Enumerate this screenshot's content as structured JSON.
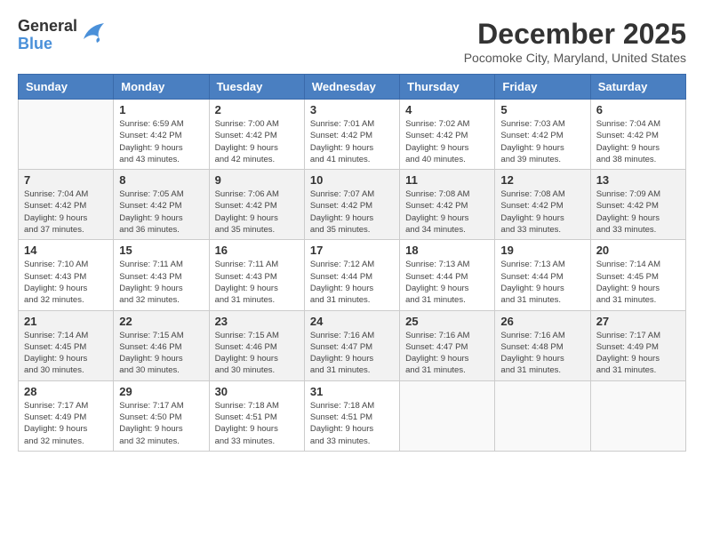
{
  "header": {
    "logo": {
      "general": "General",
      "blue": "Blue"
    },
    "title": "December 2025",
    "location": "Pocomoke City, Maryland, United States"
  },
  "calendar": {
    "weekdays": [
      "Sunday",
      "Monday",
      "Tuesday",
      "Wednesday",
      "Thursday",
      "Friday",
      "Saturday"
    ],
    "rows": [
      [
        {
          "day": "",
          "info": ""
        },
        {
          "day": "1",
          "info": "Sunrise: 6:59 AM\nSunset: 4:42 PM\nDaylight: 9 hours\nand 43 minutes."
        },
        {
          "day": "2",
          "info": "Sunrise: 7:00 AM\nSunset: 4:42 PM\nDaylight: 9 hours\nand 42 minutes."
        },
        {
          "day": "3",
          "info": "Sunrise: 7:01 AM\nSunset: 4:42 PM\nDaylight: 9 hours\nand 41 minutes."
        },
        {
          "day": "4",
          "info": "Sunrise: 7:02 AM\nSunset: 4:42 PM\nDaylight: 9 hours\nand 40 minutes."
        },
        {
          "day": "5",
          "info": "Sunrise: 7:03 AM\nSunset: 4:42 PM\nDaylight: 9 hours\nand 39 minutes."
        },
        {
          "day": "6",
          "info": "Sunrise: 7:04 AM\nSunset: 4:42 PM\nDaylight: 9 hours\nand 38 minutes."
        }
      ],
      [
        {
          "day": "7",
          "info": "Sunrise: 7:04 AM\nSunset: 4:42 PM\nDaylight: 9 hours\nand 37 minutes."
        },
        {
          "day": "8",
          "info": "Sunrise: 7:05 AM\nSunset: 4:42 PM\nDaylight: 9 hours\nand 36 minutes."
        },
        {
          "day": "9",
          "info": "Sunrise: 7:06 AM\nSunset: 4:42 PM\nDaylight: 9 hours\nand 35 minutes."
        },
        {
          "day": "10",
          "info": "Sunrise: 7:07 AM\nSunset: 4:42 PM\nDaylight: 9 hours\nand 35 minutes."
        },
        {
          "day": "11",
          "info": "Sunrise: 7:08 AM\nSunset: 4:42 PM\nDaylight: 9 hours\nand 34 minutes."
        },
        {
          "day": "12",
          "info": "Sunrise: 7:08 AM\nSunset: 4:42 PM\nDaylight: 9 hours\nand 33 minutes."
        },
        {
          "day": "13",
          "info": "Sunrise: 7:09 AM\nSunset: 4:42 PM\nDaylight: 9 hours\nand 33 minutes."
        }
      ],
      [
        {
          "day": "14",
          "info": "Sunrise: 7:10 AM\nSunset: 4:43 PM\nDaylight: 9 hours\nand 32 minutes."
        },
        {
          "day": "15",
          "info": "Sunrise: 7:11 AM\nSunset: 4:43 PM\nDaylight: 9 hours\nand 32 minutes."
        },
        {
          "day": "16",
          "info": "Sunrise: 7:11 AM\nSunset: 4:43 PM\nDaylight: 9 hours\nand 31 minutes."
        },
        {
          "day": "17",
          "info": "Sunrise: 7:12 AM\nSunset: 4:44 PM\nDaylight: 9 hours\nand 31 minutes."
        },
        {
          "day": "18",
          "info": "Sunrise: 7:13 AM\nSunset: 4:44 PM\nDaylight: 9 hours\nand 31 minutes."
        },
        {
          "day": "19",
          "info": "Sunrise: 7:13 AM\nSunset: 4:44 PM\nDaylight: 9 hours\nand 31 minutes."
        },
        {
          "day": "20",
          "info": "Sunrise: 7:14 AM\nSunset: 4:45 PM\nDaylight: 9 hours\nand 31 minutes."
        }
      ],
      [
        {
          "day": "21",
          "info": "Sunrise: 7:14 AM\nSunset: 4:45 PM\nDaylight: 9 hours\nand 30 minutes."
        },
        {
          "day": "22",
          "info": "Sunrise: 7:15 AM\nSunset: 4:46 PM\nDaylight: 9 hours\nand 30 minutes."
        },
        {
          "day": "23",
          "info": "Sunrise: 7:15 AM\nSunset: 4:46 PM\nDaylight: 9 hours\nand 30 minutes."
        },
        {
          "day": "24",
          "info": "Sunrise: 7:16 AM\nSunset: 4:47 PM\nDaylight: 9 hours\nand 31 minutes."
        },
        {
          "day": "25",
          "info": "Sunrise: 7:16 AM\nSunset: 4:47 PM\nDaylight: 9 hours\nand 31 minutes."
        },
        {
          "day": "26",
          "info": "Sunrise: 7:16 AM\nSunset: 4:48 PM\nDaylight: 9 hours\nand 31 minutes."
        },
        {
          "day": "27",
          "info": "Sunrise: 7:17 AM\nSunset: 4:49 PM\nDaylight: 9 hours\nand 31 minutes."
        }
      ],
      [
        {
          "day": "28",
          "info": "Sunrise: 7:17 AM\nSunset: 4:49 PM\nDaylight: 9 hours\nand 32 minutes."
        },
        {
          "day": "29",
          "info": "Sunrise: 7:17 AM\nSunset: 4:50 PM\nDaylight: 9 hours\nand 32 minutes."
        },
        {
          "day": "30",
          "info": "Sunrise: 7:18 AM\nSunset: 4:51 PM\nDaylight: 9 hours\nand 33 minutes."
        },
        {
          "day": "31",
          "info": "Sunrise: 7:18 AM\nSunset: 4:51 PM\nDaylight: 9 hours\nand 33 minutes."
        },
        {
          "day": "",
          "info": ""
        },
        {
          "day": "",
          "info": ""
        },
        {
          "day": "",
          "info": ""
        }
      ]
    ]
  }
}
